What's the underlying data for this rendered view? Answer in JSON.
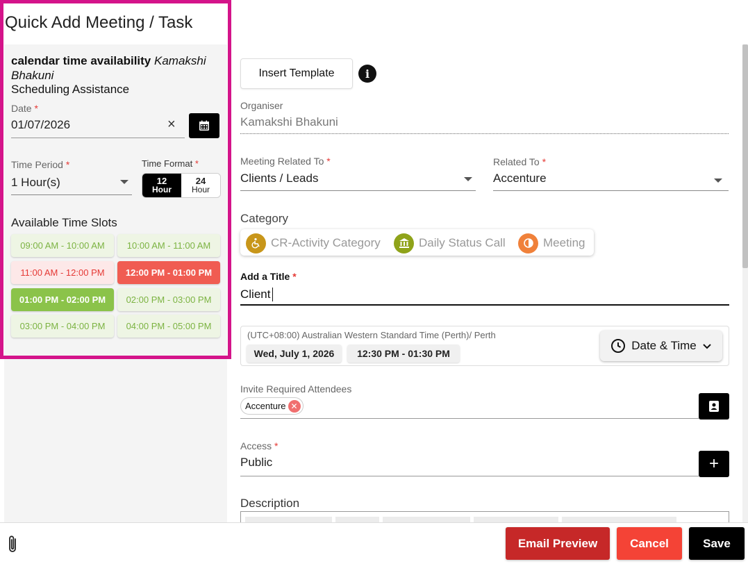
{
  "dialog": {
    "title": "Quick Add Meeting / Task"
  },
  "left": {
    "availability_label": "calendar time availability",
    "availability_person": "Kamakshi Bhakuni",
    "scheduling_label": "Scheduling Assistance",
    "date": {
      "label": "Date",
      "required": "*",
      "value": "01/07/2026",
      "clear": "×"
    },
    "time_period": {
      "label": "Time Period",
      "required": "*",
      "value": "1 Hour(s)"
    },
    "time_format": {
      "label": "Time Format",
      "required": "*",
      "options": [
        {
          "num": "12",
          "unit": "Hour",
          "active": true
        },
        {
          "num": "24",
          "unit": "Hour",
          "active": false
        }
      ]
    },
    "slots_title": "Available Time Slots",
    "slots": [
      {
        "label": "09:00 AM - 10:00 AM",
        "state": "free"
      },
      {
        "label": "10:00 AM - 11:00 AM",
        "state": "free"
      },
      {
        "label": "11:00 AM - 12:00 PM",
        "state": "busy"
      },
      {
        "label": "12:00 PM - 01:00 PM",
        "state": "selected-red"
      },
      {
        "label": "01:00 PM - 02:00 PM",
        "state": "selected-green"
      },
      {
        "label": "02:00 PM - 03:00 PM",
        "state": "free"
      },
      {
        "label": "03:00 PM - 04:00 PM",
        "state": "free"
      },
      {
        "label": "04:00 PM - 05:00 PM",
        "state": "free"
      }
    ]
  },
  "right": {
    "insert_template": "Insert Template",
    "info_icon": "i",
    "organiser": {
      "label": "Organiser",
      "value": "Kamakshi Bhakuni"
    },
    "meeting_related_to": {
      "label": "Meeting Related To",
      "required": "*",
      "value": "Clients / Leads"
    },
    "related_to": {
      "label": "Related To",
      "required": "*",
      "value": "Accenture"
    },
    "category": {
      "label": "Category",
      "chips": [
        {
          "label": "CR-Activity Category",
          "color": "#c8961a",
          "icon": "wheelchair-icon"
        },
        {
          "label": "Daily Status Call",
          "color": "#8fa31a",
          "icon": "bank-icon"
        },
        {
          "label": "Meeting",
          "color": "#f0813a",
          "icon": "pie-icon"
        }
      ]
    },
    "title": {
      "label": "Add a Title",
      "required": "*",
      "value": "Client"
    },
    "datetime": {
      "timezone": "(UTC+08:00) Australian Western Standard Time (Perth)/ Perth",
      "date": "Wed, July 1, 2026",
      "time": "12:30 PM - 01:30 PM",
      "button": "Date & Time"
    },
    "attendees": {
      "label": "Invite Required Attendees",
      "chips": [
        "Accenture"
      ]
    },
    "access": {
      "label": "Access",
      "required": "*",
      "value": "Public"
    },
    "description": {
      "label": "Description"
    }
  },
  "footer": {
    "email_preview": "Email Preview",
    "cancel": "Cancel",
    "save": "Save"
  },
  "colors": {
    "highlight_border": "#d4148a",
    "email_preview": "#c62828",
    "cancel": "#f44336",
    "save": "#000000",
    "slot_free_text": "#7cb342",
    "slot_busy_text": "#e53935"
  }
}
